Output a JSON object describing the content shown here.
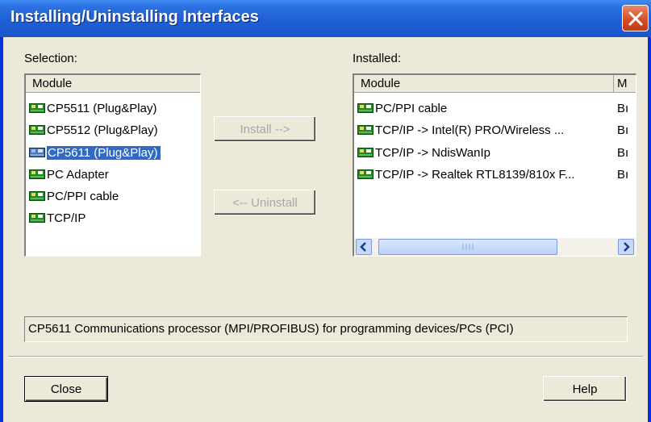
{
  "window": {
    "title": "Installing/Uninstalling Interfaces"
  },
  "selection": {
    "label": "Selection:",
    "column": "Module",
    "items": [
      {
        "label": "CP5511 (Plug&Play)",
        "selected": false
      },
      {
        "label": "CP5512 (Plug&Play)",
        "selected": false
      },
      {
        "label": "CP5611 (Plug&Play)",
        "selected": true
      },
      {
        "label": "PC Adapter",
        "selected": false
      },
      {
        "label": "PC/PPI cable",
        "selected": false
      },
      {
        "label": "TCP/IP",
        "selected": false
      }
    ]
  },
  "installed": {
    "label": "Installed:",
    "columns": [
      "Module",
      "M"
    ],
    "rows": [
      {
        "module": "PC/PPI cable",
        "col2": "Bı"
      },
      {
        "module": "TCP/IP -> Intel(R) PRO/Wireless ...",
        "col2": "Bı"
      },
      {
        "module": "TCP/IP -> NdisWanIp",
        "col2": "Bı"
      },
      {
        "module": "TCP/IP -> Realtek RTL8139/810x F...",
        "col2": "Bı"
      }
    ]
  },
  "buttons": {
    "install": "Install -->",
    "uninstall": "<-- Uninstall",
    "close": "Close",
    "help": "Help"
  },
  "description": "CP5611 Communications processor (MPI/PROFIBUS) for programming devices/PCs (PCI)",
  "icons": {
    "title_close": "close-icon",
    "module": "network-card-icon",
    "scroll_left": "arrow-left-icon",
    "scroll_right": "arrow-right-icon"
  },
  "colors": {
    "titlebar": "#1f5fd6",
    "selection": "#316ac5",
    "dialog": "#ece9d8"
  }
}
